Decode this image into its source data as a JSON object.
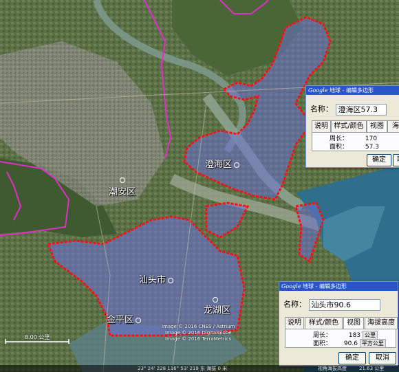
{
  "colors": {
    "boundary": "#e02ec8",
    "outline": "#ff1010",
    "fill": "#6a6fd0"
  },
  "places": {
    "chaoan": "潮安区",
    "chenghai": "澄海区",
    "shantou": "汕头市",
    "longhu": "龙湖区",
    "jinping": "金平区"
  },
  "dialog_chenghai": {
    "title_app": "Google",
    "title_rest": "地球 - 编辑多边形",
    "name_label": "名称：",
    "name_value": "澄海区57.3",
    "tabs": [
      "说明",
      "样式/颜色",
      "视图",
      "海"
    ],
    "perimeter_label": "周长：",
    "perimeter_value": "170",
    "area_label": "面积：",
    "area_value": "57.3",
    "ok_label": "确定",
    "cancel_label": "取"
  },
  "dialog_shantou": {
    "title_app": "Google",
    "title_rest": "地球 - 编辑多边形",
    "name_label": "名称：",
    "name_value": "汕头市90.6",
    "tabs": [
      "说明",
      "样式/颜色",
      "视图",
      "海拔高度"
    ],
    "perimeter_label": "周长：",
    "perimeter_value": "183",
    "perimeter_unit": "公里",
    "area_label": "面积：",
    "area_value": "90.6",
    "area_unit": "平方公里",
    "ok_label": "确定",
    "cancel_label": "取消"
  },
  "credits": [
    "Image © 2016 CNES / Astrium",
    "Image © 2016 DigitalGlobe",
    "Image © 2016 TerraMetrics"
  ],
  "scale_label": "8.00 公里",
  "status_bar": {
    "coords": "23° 24' 228   116° 53' 219   东  海拔    0 米",
    "view": "视角海拔高度",
    "alt": "21.63 公里"
  }
}
